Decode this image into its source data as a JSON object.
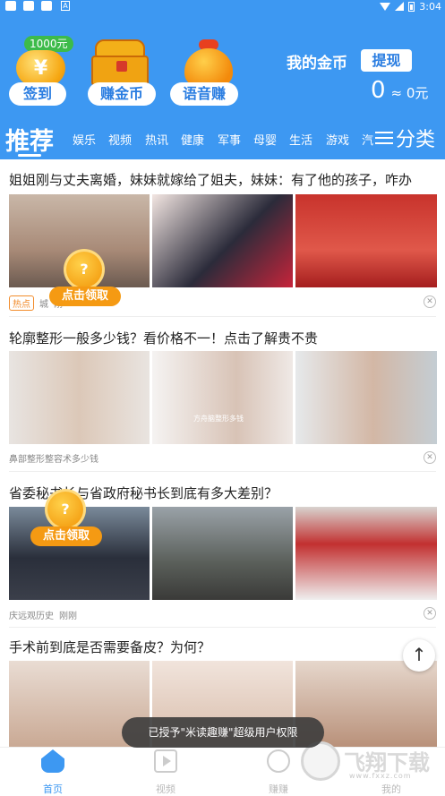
{
  "statusbar": {
    "time": "3:04",
    "indicator": "A"
  },
  "header": {
    "badge_1000": "1000元",
    "coin_symbol": "¥",
    "buttons": [
      "签到",
      "赚金币",
      "语音赚"
    ],
    "my_coins_label": "我的金币",
    "withdraw_label": "提现",
    "coin_balance": "0",
    "cash_balance": "≈ 0元"
  },
  "tabs": {
    "active": "推荐",
    "items": [
      "娱乐",
      "视频",
      "热讯",
      "健康",
      "军事",
      "母婴",
      "生活",
      "游戏",
      "汽"
    ],
    "category_label": "分类"
  },
  "feed": [
    {
      "title": "姐姐刚与丈夫离婚，妹妹就嫁给了姐夫，妹妹：有了他的孩子，咋办",
      "hot_tag": "热点",
      "source": "城",
      "time": "刚"
    },
    {
      "title": "轮廓整形一般多少钱？看价格不一！点击了解贵不贵",
      "overlay_caption": "方舟脑整形多钱",
      "source": "鼻部整形整容术多少钱"
    },
    {
      "title": "省委秘书长与省政府秘书长到底有多大差别？",
      "source": "庆远观历史",
      "time": "刚刚"
    },
    {
      "title": "手术前到底是否需要备皮？为何？"
    }
  ],
  "claim_widget": {
    "coin_mark": "?",
    "label": "点击领取"
  },
  "toast": "已授予\"米读趣赚\"超级用户权限",
  "bottom_nav": [
    "首页",
    "视频",
    "赚赚",
    "我的"
  ],
  "watermark": {
    "text": "飞翔下载",
    "sub": "www.fxxz.com"
  },
  "colors": {
    "brand_blue": "#3d98f2",
    "coin_orange": "#f59a13",
    "hot_orange": "#f28c2c",
    "green_badge": "#3dbb4a"
  }
}
